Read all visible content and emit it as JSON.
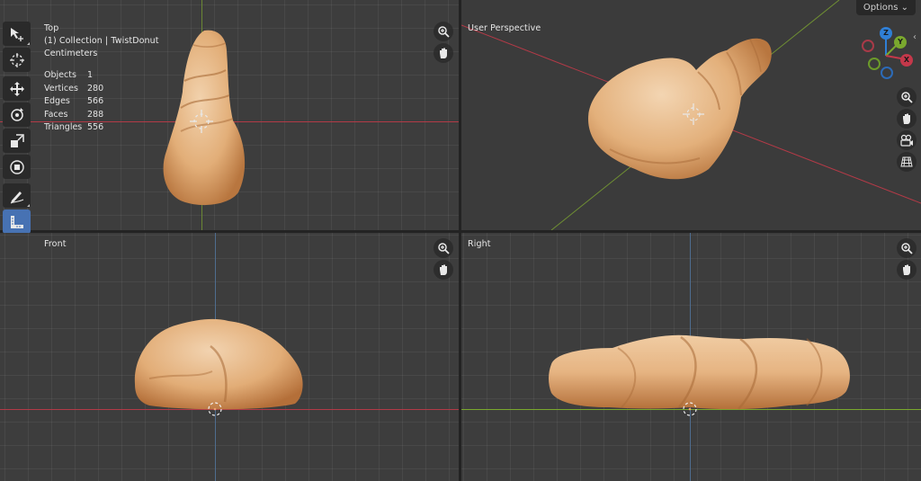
{
  "top_view": {
    "title": "Top",
    "collection": "(1) Collection | TwistDonut",
    "units": "Centimeters",
    "stats": [
      {
        "key": "Objects",
        "value": "1"
      },
      {
        "key": "Vertices",
        "value": "280"
      },
      {
        "key": "Edges",
        "value": "566"
      },
      {
        "key": "Faces",
        "value": "288"
      },
      {
        "key": "Triangles",
        "value": "556"
      }
    ]
  },
  "perspective_view": {
    "title": "User Perspective"
  },
  "front_view": {
    "title": "Front"
  },
  "right_view": {
    "title": "Right"
  },
  "header": {
    "options_label": "Options",
    "options_chevron": "⌄"
  },
  "gizmo": {
    "z": "Z",
    "y": "Y",
    "x": "X"
  },
  "colors": {
    "x_axis": "#c4384a",
    "y_axis": "#7aa82e",
    "z_axis": "#2f7fd6",
    "active_tool": "#4772b3",
    "bread_light": "#e8b785",
    "bread_dark": "#b9743f"
  },
  "icons": {
    "tools": [
      "select-box-icon",
      "cursor-icon",
      "move-icon",
      "rotate-icon",
      "scale-icon",
      "transform-icon",
      "annotate-icon",
      "measure-icon",
      "add-cube-icon",
      "extrude-icon"
    ],
    "nav": [
      "zoom-icon",
      "pan-icon",
      "camera-icon",
      "grid-icon"
    ]
  }
}
